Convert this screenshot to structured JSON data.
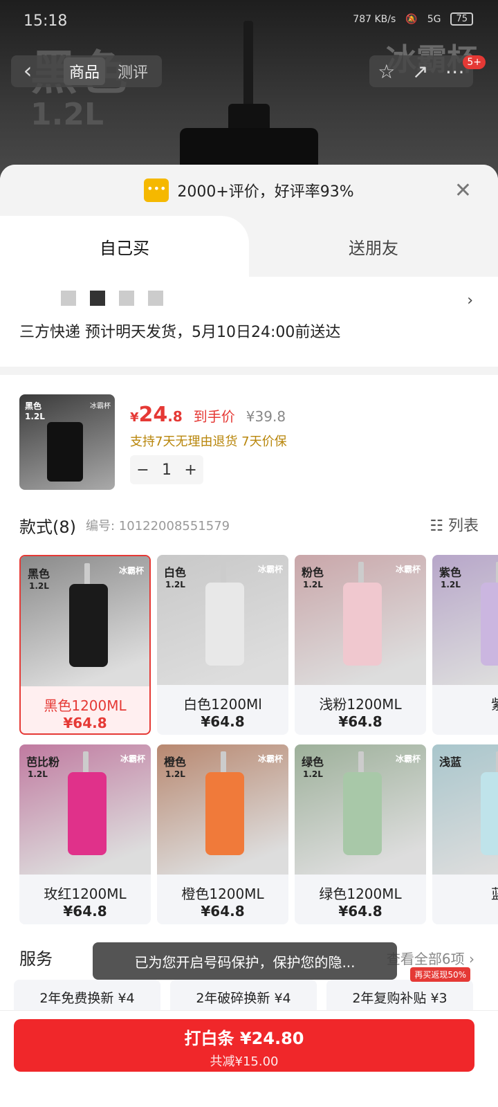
{
  "status": {
    "time": "15:18",
    "net_speed": "787 KB/s",
    "network": "5G",
    "battery": "75"
  },
  "hero": {
    "left_big": "黑色",
    "left_small": "1.2L",
    "right": "冰霸杯"
  },
  "nav": {
    "back_glyph": "‹",
    "tabs": [
      "商品",
      "测评"
    ],
    "badge": "5+",
    "icons": [
      "star-icon",
      "share-icon",
      "more-icon"
    ]
  },
  "sheet": {
    "review": {
      "text": "2000+评价，好评率93%"
    },
    "buy_tabs": [
      "自己买",
      "送朋友"
    ],
    "address": {
      "delivery": "三方快递 预计明天发货，5月10日24:00前送达"
    },
    "product": {
      "price_currency": "¥",
      "price_int": "24",
      "price_dec": ".8",
      "price_label": "到手价",
      "old_price": "¥39.8",
      "services": "支持7天无理由退货  7天价保",
      "qty": "1",
      "thumb_color": "黑色",
      "thumb_size": "1.2L",
      "thumb_brand": "冰霸杯"
    },
    "styles": {
      "title": "款式(8)",
      "code": "编号: 10122008551579",
      "list_label": "列表",
      "items": [
        {
          "tag": "黑色",
          "size": "1.2L",
          "brand": "冰霸杯",
          "name": "黑色1200ML",
          "price": "¥64.8",
          "color": "#1a1a1a",
          "bg": "#8a8a8a"
        },
        {
          "tag": "白色",
          "size": "1.2L",
          "brand": "冰霸杯",
          "name": "白色1200Ml",
          "price": "¥64.8",
          "color": "#e8e8e8",
          "bg": "#c8c8c8"
        },
        {
          "tag": "粉色",
          "size": "1.2L",
          "brand": "冰霸杯",
          "name": "浅粉1200ML",
          "price": "¥64.8",
          "color": "#f0c8cf",
          "bg": "#c9a6a9"
        },
        {
          "tag": "紫色",
          "size": "1.2L",
          "brand": "",
          "name": "紫",
          "price": "",
          "color": "#cbb6e0",
          "bg": "#b7a6c9"
        },
        {
          "tag": "芭比粉",
          "size": "1.2L",
          "brand": "冰霸杯",
          "name": "玫红1200ML",
          "price": "¥64.8",
          "color": "#e0318a",
          "bg": "#c07aa0"
        },
        {
          "tag": "橙色",
          "size": "1.2L",
          "brand": "冰霸杯",
          "name": "橙色1200ML",
          "price": "¥64.8",
          "color": "#f07a3a",
          "bg": "#b88870"
        },
        {
          "tag": "绿色",
          "size": "1.2L",
          "brand": "冰霸杯",
          "name": "绿色1200ML",
          "price": "¥64.8",
          "color": "#a8c8a8",
          "bg": "#9db09a"
        },
        {
          "tag": "浅蓝",
          "size": "",
          "brand": "",
          "name": "蓝",
          "price": "",
          "color": "#bfe3ea",
          "bg": "#a9c6cc"
        }
      ]
    },
    "service": {
      "title": "服务",
      "all": "查看全部6项 ›",
      "items": [
        "2年免费换新 ¥4",
        "2年破碎换新 ¥4",
        "2年复购补贴 ¥3"
      ],
      "badge": "再买返现50%"
    },
    "toast": "已为您开启号码保护，保护您的隐...",
    "footer": {
      "main": "打白条 ¥24.80",
      "sub": "共减¥15.00"
    }
  }
}
